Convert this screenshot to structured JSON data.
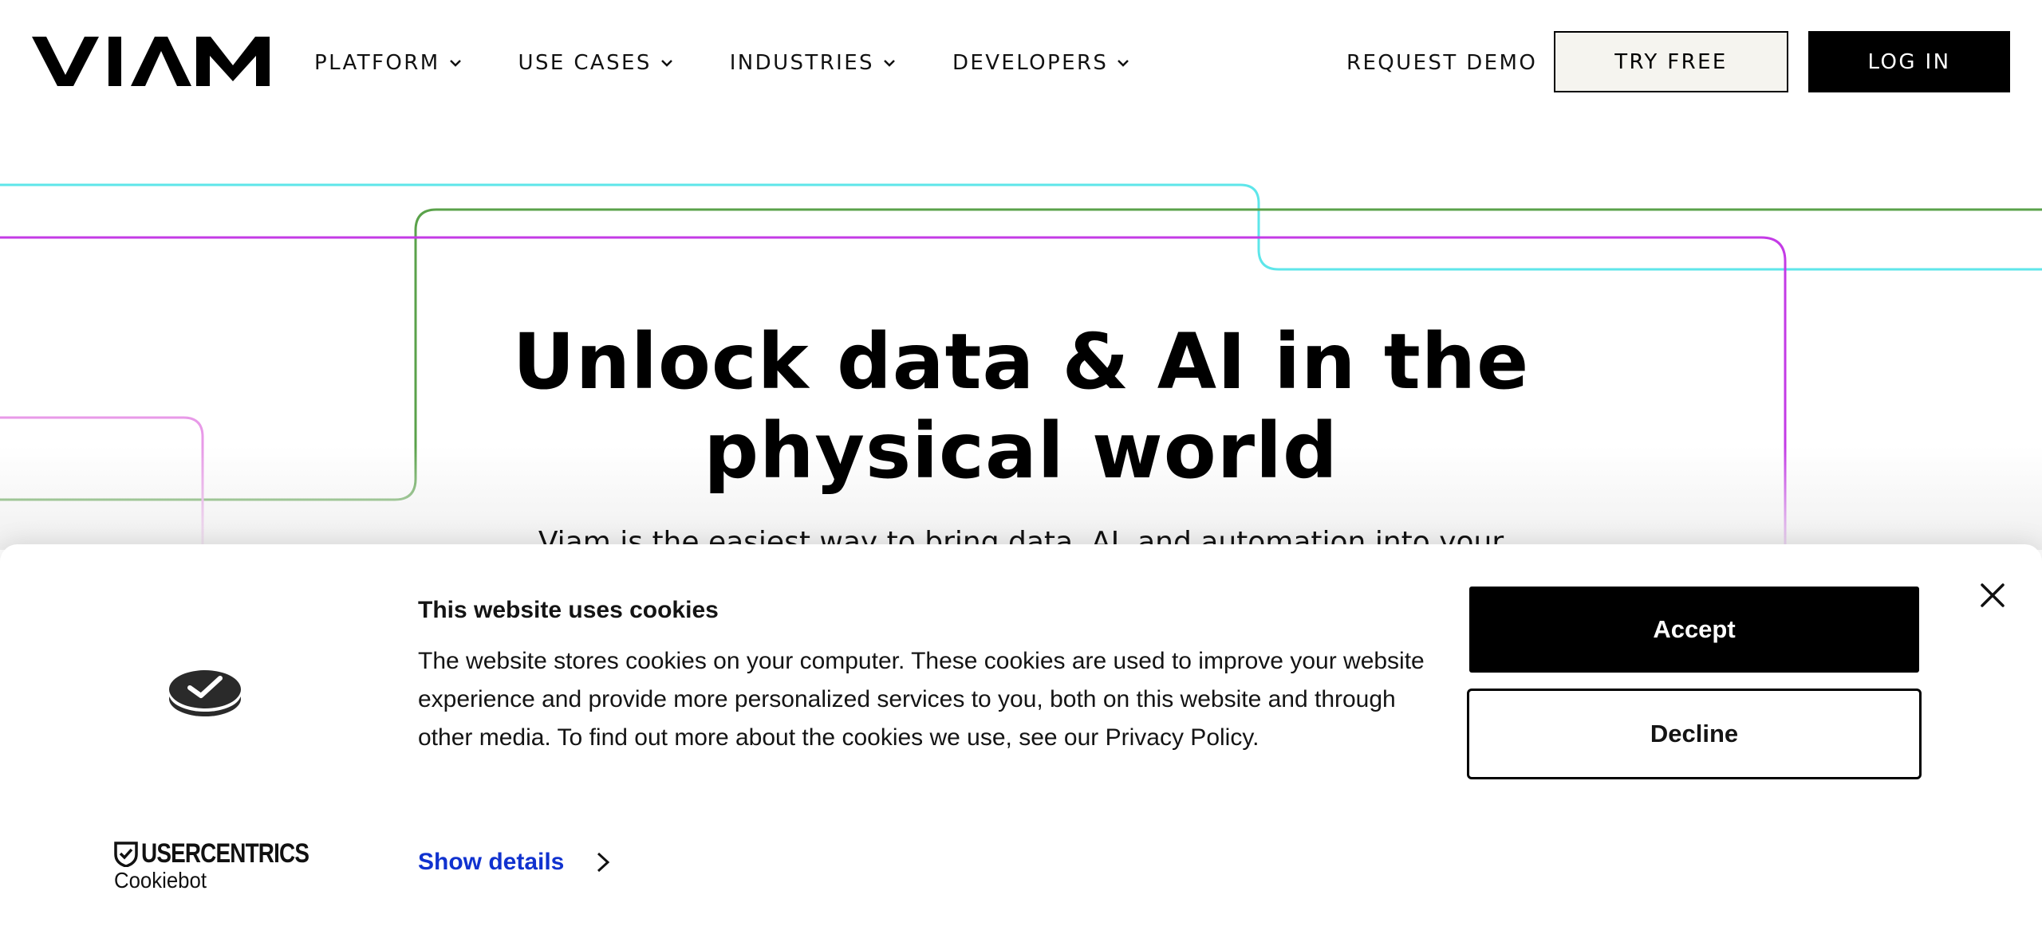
{
  "header": {
    "logo_text": "VIAM",
    "nav": [
      {
        "label": "PLATFORM"
      },
      {
        "label": "USE CASES"
      },
      {
        "label": "INDUSTRIES"
      },
      {
        "label": "DEVELOPERS"
      }
    ],
    "request_demo": "REQUEST DEMO",
    "try_free": "TRY FREE",
    "log_in": "LOG IN"
  },
  "hero": {
    "title_line1": "Unlock data & AI in the",
    "title_line2": "physical world",
    "subtitle": "Viam is the easiest way to bring data, AI, and automation into your"
  },
  "cookie": {
    "title": "This website uses cookies",
    "body": "The website stores cookies on your computer. These cookies are used to improve your website experience and provide more personalized services to you, both on this website and through other media. To find out more about the cookies we use, see our Privacy Policy.",
    "accept": "Accept",
    "decline": "Decline",
    "show_details": "Show details",
    "brand_name": "USERCENTRICS",
    "brand_sub": "Cookiebot"
  },
  "colors": {
    "cyan": "#5ee6ea",
    "green": "#5aa24a",
    "purple": "#c43be6",
    "pink": "#e89ae8",
    "link_blue": "#1032cf",
    "try_free_bg": "#f5f4ef"
  },
  "icons": [
    "chevron-down-icon",
    "cookie-consent-icon",
    "close-icon",
    "shield-check-icon",
    "chevron-right-icon"
  ]
}
